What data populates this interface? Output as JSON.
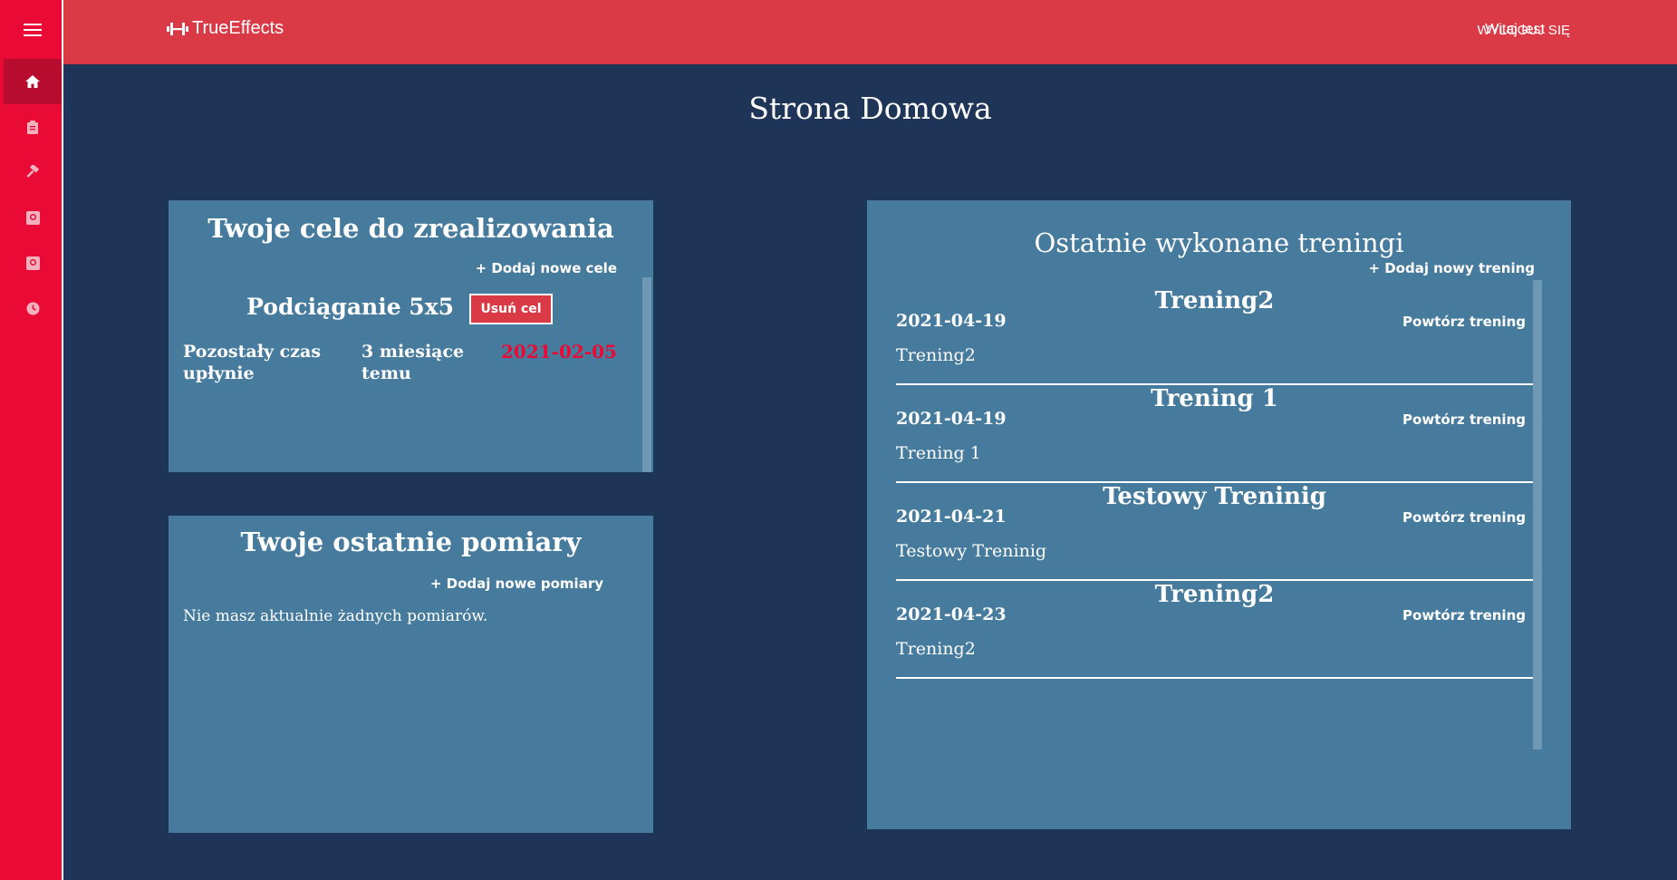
{
  "app": {
    "brand": "TrueEffects",
    "accent": "#da3a46",
    "sidebar_color": "#e90b35",
    "background": "#1f3558",
    "card_color": "#477b9d"
  },
  "sidebar": {
    "items": [
      {
        "icon": "menu-icon"
      },
      {
        "icon": "home-icon",
        "active": true
      },
      {
        "icon": "clipboard-icon"
      },
      {
        "icon": "hammer-icon"
      },
      {
        "icon": "scale-icon"
      },
      {
        "icon": "scale-icon"
      },
      {
        "icon": "clock-icon"
      }
    ]
  },
  "header": {
    "greeting": "Witaj test",
    "logout_label": "WYLOGUJ SIĘ"
  },
  "page": {
    "title": "Strona Domowa"
  },
  "goals": {
    "title": "Twoje cele do zrealizowania",
    "add_label": "+ Dodaj nowe cele",
    "items": [
      {
        "name": "Podciąganie 5x5",
        "delete_label": "Usuń cel",
        "remaining_label": "Pozostały czas upłynie",
        "remaining_value": "3 miesiące temu",
        "date": "2021-02-05",
        "date_color": "#e90b35"
      }
    ]
  },
  "measurements": {
    "title": "Twoje ostatnie pomiary",
    "add_label": "+ Dodaj nowe pomiary",
    "empty_text": "Nie masz aktualnie żadnych pomiarów."
  },
  "trainings": {
    "title": "Ostatnie wykonane treningi",
    "add_label": "+ Dodaj nowy trening",
    "items": [
      {
        "title": "Trening2",
        "date": "2021-04-19",
        "repeat_label": "Powtórz trening",
        "name": "Trening2"
      },
      {
        "title": "Trening 1",
        "date": "2021-04-19",
        "repeat_label": "Powtórz trening",
        "name": "Trening 1"
      },
      {
        "title": "Testowy Treninig",
        "date": "2021-04-21",
        "repeat_label": "Powtórz trening",
        "name": "Testowy Treninig"
      },
      {
        "title": "Trening2",
        "date": "2021-04-23",
        "repeat_label": "Powtórz trening",
        "name": "Trening2"
      }
    ]
  }
}
